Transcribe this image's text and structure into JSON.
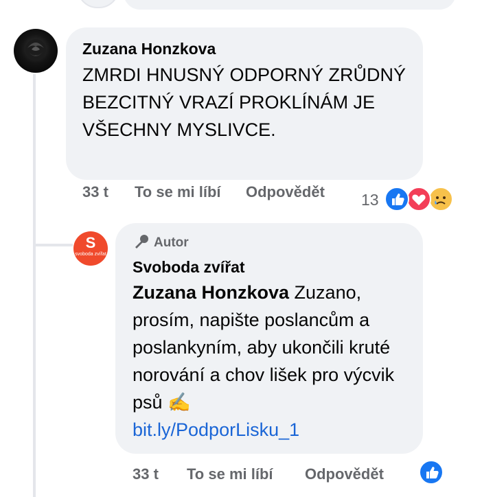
{
  "comment": {
    "author": "Zuzana Honzkova",
    "text": "ZMRDI HNUSNÝ ODPORNÝ ZRŮDNÝ BEZCITNÝ VRAZÍ PROKLÍNÁM JE VŠECHNY MYSLIVCE.",
    "time": "33 t",
    "like_label": "To se mi líbí",
    "reply_label": "Odpovědět",
    "reaction_count": "13",
    "reactions": [
      "like-icon",
      "love-icon",
      "sad-icon"
    ]
  },
  "reply": {
    "badge": "Autor",
    "author": "Svoboda zvířat",
    "avatar_letter": "S",
    "avatar_text": "svoboda zvířat",
    "mention": "Zuzana Honzkova",
    "text": " Zuzano, prosím, napište poslancům a poslankyním, aby ukončili kruté norování a chov lišek pro výcvik psů ✍️",
    "link": "bit.ly/PodporLisku_1",
    "time": "33 t",
    "like_label": "To se mi líbí",
    "reply_label": "Odpovědět",
    "reactions": [
      "like-icon"
    ]
  },
  "colors": {
    "bubble": "#f0f2f5",
    "meta_text": "#65676b",
    "link": "#1a65d6",
    "like_blue": "#1877f2",
    "love_red": "#f33e58",
    "sad_yellow": "#f7c14b"
  }
}
